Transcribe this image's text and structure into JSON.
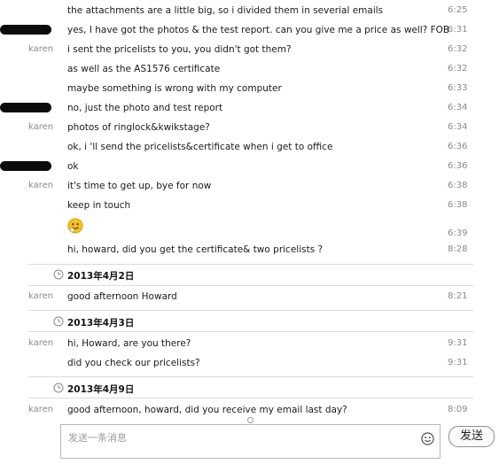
{
  "messages_top": [
    {
      "sender": "",
      "redacted": false,
      "text": "the attachments are a little big, so i divided them in severial emails",
      "time": "6:25"
    },
    {
      "sender": "",
      "redacted": true,
      "text": "yes, I have got the photos & the test report. can you give me a price as well? FOB",
      "time": "6:31"
    },
    {
      "sender": "karen",
      "redacted": false,
      "text": "i sent the pricelists to you, you didn't got them?",
      "time": "6:32"
    },
    {
      "sender": "",
      "redacted": false,
      "text": "as well as the AS1576 certificate",
      "time": "6:32"
    },
    {
      "sender": "",
      "redacted": false,
      "text": "maybe something is wrong with my computer",
      "time": "6:33"
    },
    {
      "sender": "",
      "redacted": true,
      "text": "no, just the photo and test report",
      "time": "6:34"
    },
    {
      "sender": "karen",
      "redacted": false,
      "text": " photos of ringlock&kwikstage?",
      "time": "6:34"
    },
    {
      "sender": "",
      "redacted": false,
      "text": "ok, i 'll send the pricelists&certificate when i get to office",
      "time": "6:36"
    },
    {
      "sender": "",
      "redacted": true,
      "text": "ok",
      "time": "6:36"
    },
    {
      "sender": "karen",
      "redacted": false,
      "text": "it's time to get up, bye for now",
      "time": "6:38"
    },
    {
      "sender": "",
      "redacted": false,
      "text": "keep in touch",
      "time": "6:38"
    },
    {
      "sender": "",
      "redacted": false,
      "emoji": "smiley-face-icon",
      "text": "",
      "time": "6:39"
    },
    {
      "sender": "",
      "redacted": false,
      "text": "hi, howard, did you get the certificate& two pricelists ?",
      "time": "8:28"
    }
  ],
  "day_groups": [
    {
      "date": "2013年4月2日",
      "messages": [
        {
          "sender": "karen",
          "text": "good afternoon Howard",
          "time": "8:21"
        }
      ]
    },
    {
      "date": "2013年4月3日",
      "messages": [
        {
          "sender": "karen",
          "text": "hi, Howard, are you there?",
          "time": "9:31"
        },
        {
          "sender": "",
          "text": "did you check our pricelists?",
          "time": "9:31"
        }
      ]
    },
    {
      "date": "2013年4月9日",
      "messages": [
        {
          "sender": "karen",
          "text": "good afternoon, howard, did you receive my email last day?",
          "time": "8:09"
        }
      ]
    }
  ],
  "composer": {
    "placeholder": "发送一条消息",
    "emoji_icon": "smiley-face-icon",
    "send_label": "发送"
  },
  "colors": {
    "separator": "#dcdcdc",
    "meta_text": "#8a8a8a",
    "redaction": "#0b0b0b"
  }
}
